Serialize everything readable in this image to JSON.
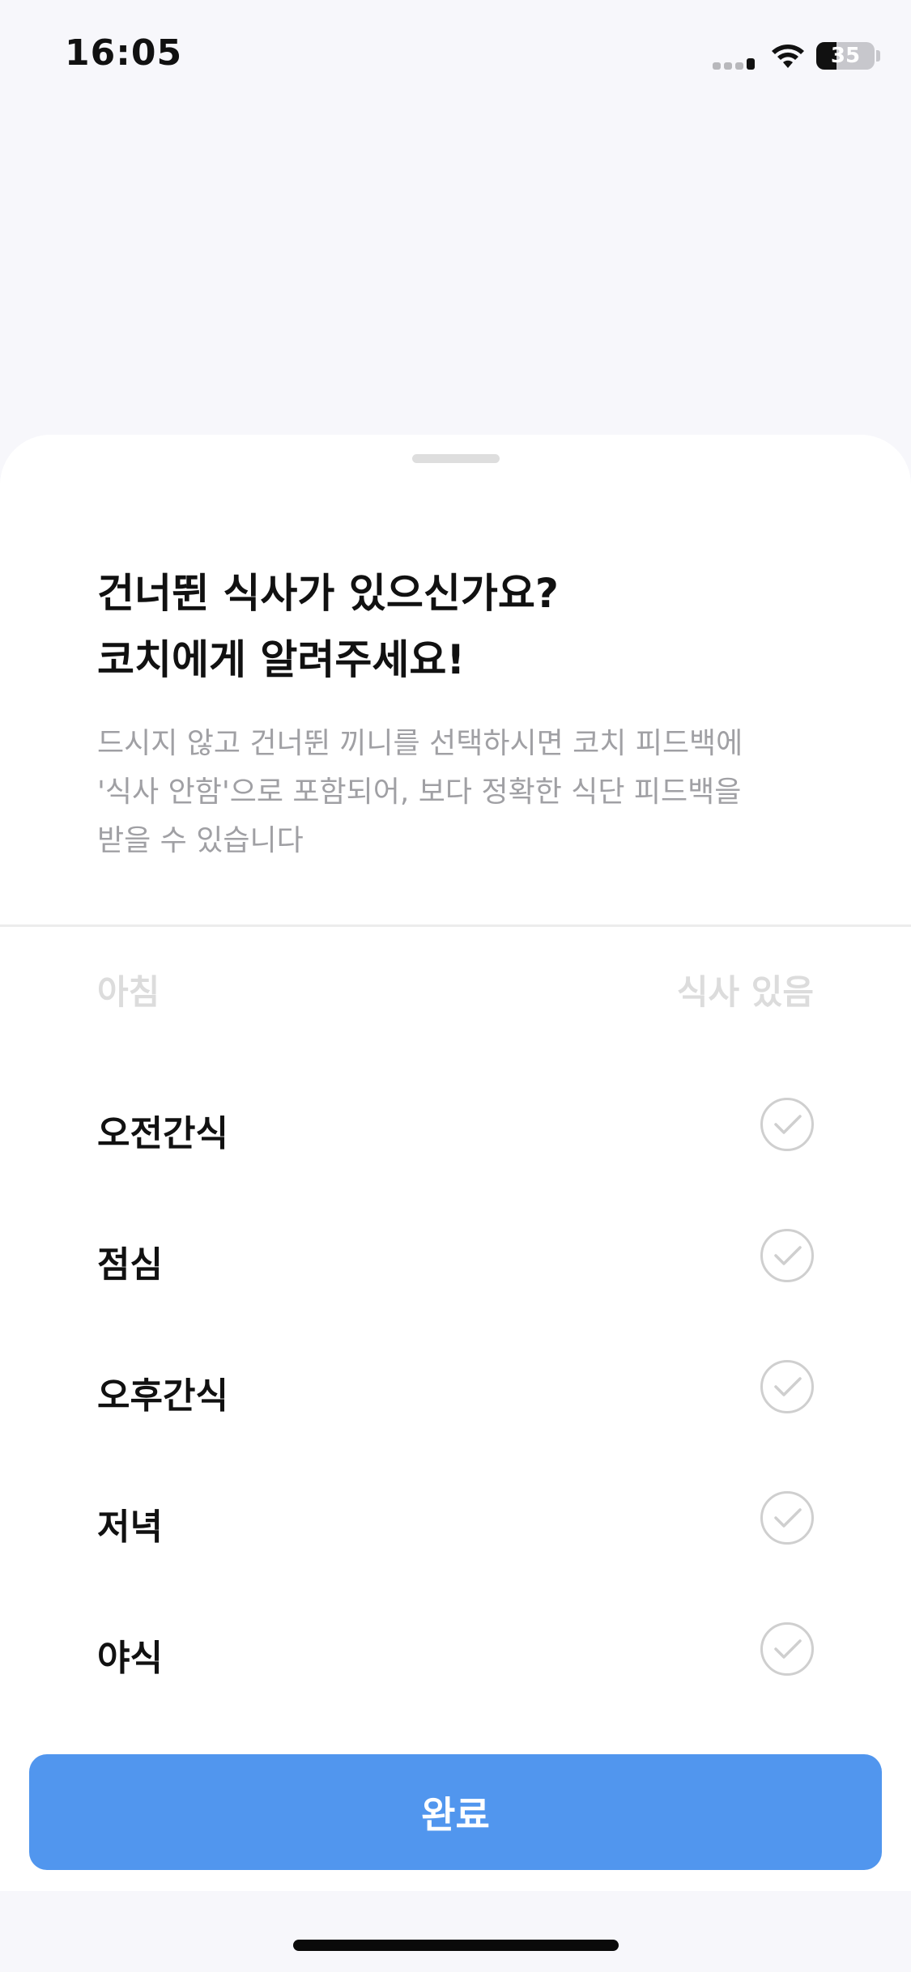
{
  "status_bar": {
    "time": "16:05",
    "battery_level": "35",
    "icons": [
      "signal-icon",
      "wifi-icon",
      "battery-icon"
    ]
  },
  "sheet": {
    "title_line1": "건너뛴 식사가 있으신가요?",
    "title_line2": "코치에게 알려주세요!",
    "description_line1": "드시지 않고 건너뛴 끼니를 선택하시면 코치 피드백에",
    "description_line2": "'식사 안함'으로 포함되어, 보다 정확한 식단 피드백을",
    "description_line3": "받을 수 있습니다",
    "header": {
      "left": "아침",
      "right": "식사 있음"
    },
    "meals": [
      {
        "label": "오전간식",
        "icon": "check-circle-icon"
      },
      {
        "label": "점심",
        "icon": "check-circle-icon"
      },
      {
        "label": "오후간식",
        "icon": "check-circle-icon"
      },
      {
        "label": "저녁",
        "icon": "check-circle-icon"
      },
      {
        "label": "야식",
        "icon": "check-circle-icon"
      }
    ],
    "done_label": "완료"
  },
  "colors": {
    "accent": "#5196ee",
    "background": "#f7f7fb",
    "sheet": "#ffffff",
    "muted_text": "#a0a0a4",
    "check_border": "#cfcfcf"
  }
}
